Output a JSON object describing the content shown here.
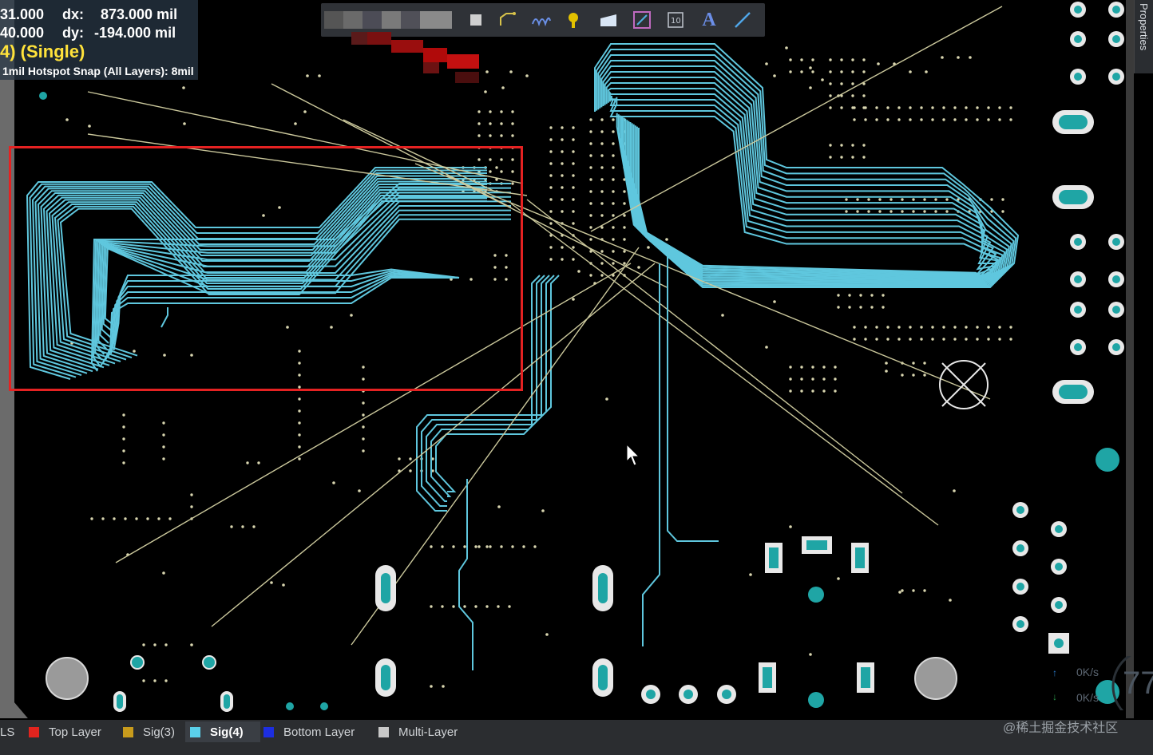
{
  "hud": {
    "x_value": "31.000",
    "dx_label": "dx:",
    "dx_value": "873.000 mil",
    "y_value": "40.000",
    "dy_label": "dy:",
    "dy_value": "-194.000  mil",
    "mode": "4) (Single)",
    "snap": "1mil Hotspot Snap (All Layers): 8mil"
  },
  "toolbar": {
    "icons": [
      "filter-icon",
      "route-icon",
      "interactive-route-icon",
      "place-via-icon",
      "place-fill-icon",
      "place-line-icon",
      "dimension-icon",
      "text-icon",
      "line-icon"
    ],
    "text_glyph": "A"
  },
  "properties_tab": "Properties",
  "layers": [
    {
      "name": "LS",
      "color": "#2b2d30"
    },
    {
      "name": "Top Layer",
      "color": "#e1241e"
    },
    {
      "name": "Sig(3)",
      "color": "#c89b1c"
    },
    {
      "name": "Sig(4)",
      "color": "#5ad0ea",
      "active": true
    },
    {
      "name": "Bottom Layer",
      "color": "#1d2ee0"
    },
    {
      "name": "Multi-Layer",
      "color": "#c8c8c8"
    }
  ],
  "net_speed": {
    "up": "0K/s",
    "down": "0K/s",
    "big": "77"
  },
  "watermark": "@稀土掘金技术社区",
  "colors": {
    "trace": "#5fc7de",
    "ratsnest": "#cbc89c",
    "pad": "#1fa5a5",
    "hole": "#e8e8e8",
    "via_dot": "#d9d6b0",
    "selection": "#e52222"
  }
}
